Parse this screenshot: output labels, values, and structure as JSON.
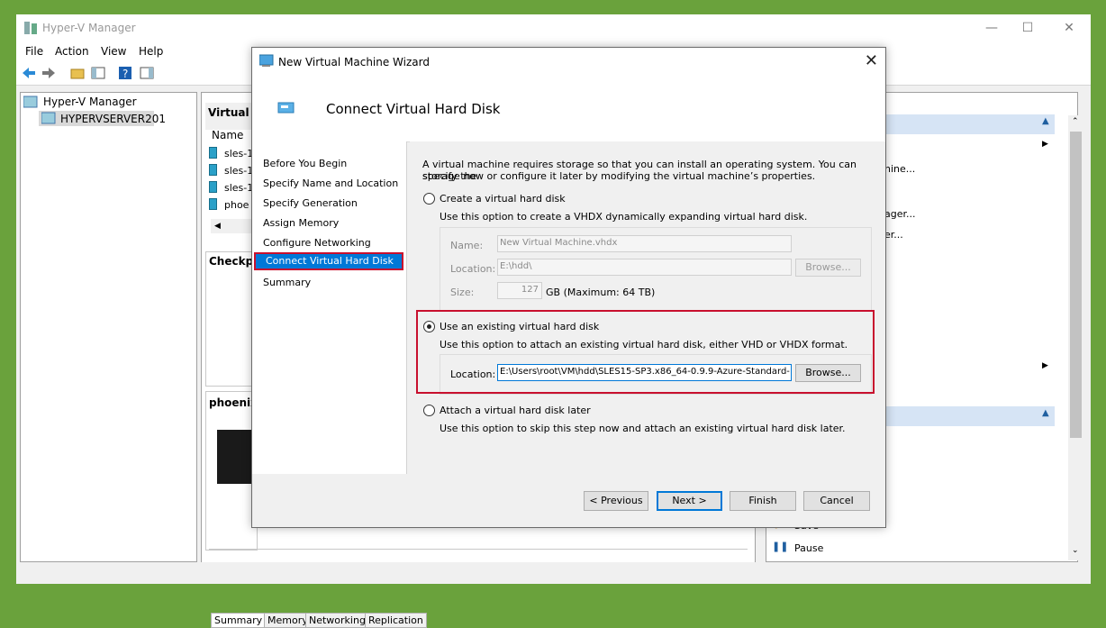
{
  "main": {
    "title": "Hyper-V Manager",
    "menu": [
      "File",
      "Action",
      "View",
      "Help"
    ],
    "tree": {
      "root": "Hyper-V Manager",
      "server": "HYPERVSERVER201"
    },
    "vm_panel_header": "Virtual M",
    "name_column": "Name",
    "vm_rows": [
      "sles-1",
      "sles-1",
      "sles-1",
      "phoe"
    ],
    "checkpoints_header": "Checkpo",
    "details_header": "phoenix",
    "bottom_tabs": [
      "Summary",
      "Memory",
      "Networking",
      "Replication"
    ],
    "actions_fragments": [
      "hine...",
      "ager...",
      "er..."
    ],
    "actions_bottom": {
      "save": "Save",
      "pause": "Pause"
    }
  },
  "wizard": {
    "title": "New Virtual Machine Wizard",
    "heading": "Connect Virtual Hard Disk",
    "steps": [
      "Before You Begin",
      "Specify Name and Location",
      "Specify Generation",
      "Assign Memory",
      "Configure Networking",
      "Connect Virtual Hard Disk",
      "Summary"
    ],
    "intro": [
      "A virtual machine requires storage so that you can install an operating system. You can specify the",
      "storage now or configure it later by modifying the virtual machine’s properties."
    ],
    "create_option": {
      "label": "Create a virtual hard disk",
      "desc": "Use this option to create a VHDX dynamically expanding virtual hard disk.",
      "name_label": "Name:",
      "name_value": "New Virtual Machine.vhdx",
      "location_label": "Location:",
      "location_value": "E:\\hdd\\",
      "size_label": "Size:",
      "size_value": "127",
      "size_suffix": "GB (Maximum: 64 TB)",
      "browse": "Browse..."
    },
    "existing_option": {
      "label": "Use an existing virtual hard disk",
      "desc": "Use this option to attach an existing virtual hard disk, either VHD or VHDX format.",
      "location_label": "Location:",
      "location_value": "E:\\Users\\root\\VM\\hdd\\SLES15-SP3.x86_64-0.9.9-Azure-Standard-",
      "browse": "Browse...",
      "selected": true
    },
    "later_option": {
      "label": "Attach a virtual hard disk later",
      "desc": "Use this option to skip this step now and attach an existing virtual hard disk later."
    },
    "buttons": {
      "previous": "< Previous",
      "next": "Next >",
      "finish": "Finish",
      "cancel": "Cancel"
    }
  },
  "colors": {
    "highlight": "#c8102e",
    "selection": "#0078d7",
    "desktop": "#6aa23c"
  }
}
